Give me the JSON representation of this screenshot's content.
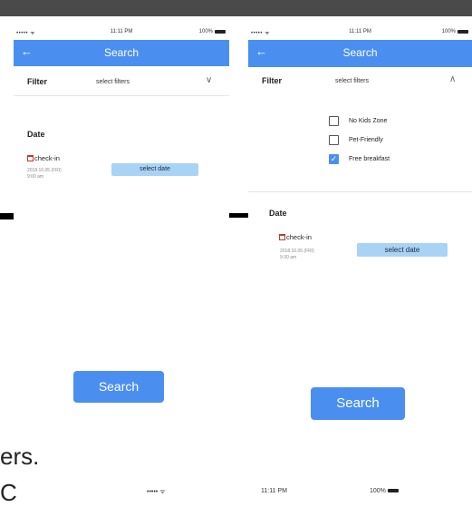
{
  "left": {
    "status": {
      "signal": "••••• ᯤ",
      "time": "11:11 PM",
      "battery": "100%"
    },
    "nav": {
      "back": "←",
      "title": "Search"
    },
    "filter": {
      "label": "Filter",
      "value": "select filters",
      "chevron": "∨"
    },
    "date": {
      "heading": "Date",
      "checkin_label": "check-in",
      "checkin_date": "2018.10.05 (FRI)",
      "checkin_time": "9:00 am",
      "select_label": "select date"
    },
    "search_label": "Search"
  },
  "right": {
    "status": {
      "signal": "••••• ᯤ",
      "time": "11:11 PM",
      "battery": "100%"
    },
    "nav": {
      "back": "←",
      "title": "Search"
    },
    "filter": {
      "label": "Filter",
      "value": "select filters",
      "chevron": "∧"
    },
    "options": [
      {
        "label": "No Kids Zone",
        "checked": false
      },
      {
        "label": "Pet-Friendly",
        "checked": false
      },
      {
        "label": "Free breakfast",
        "checked": true
      }
    ],
    "date": {
      "heading": "Date",
      "checkin_label": "check-in",
      "checkin_date": "2018.10.05 (FRI)",
      "checkin_time": "9:30 am",
      "select_label": "select date"
    },
    "search_label": "Search"
  },
  "page_text": {
    "bottom_fragment": "ers.",
    "bottom_fragment2": "C",
    "bottom_signal": "••••• ᯤ",
    "bottom_time": "11:11 PM",
    "bottom_battery": "100%"
  },
  "colors": {
    "primary": "#4a8ff0",
    "pill": "#a9d3f5",
    "checkbox_checked": "#4a8ff0"
  }
}
